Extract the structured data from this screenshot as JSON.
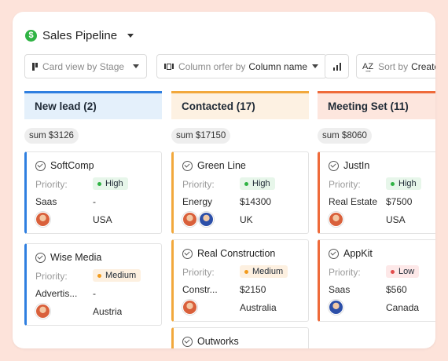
{
  "header": {
    "title": "Sales Pipeline",
    "icon": "dollar-icon"
  },
  "toolbar": {
    "view_label": "Card view by Stage",
    "column_order_prefix": "Column orfer by",
    "column_order_value": "Column name",
    "sort_prefix": "Sort by",
    "sort_value": "Create"
  },
  "colors": {
    "new_lead": "#2f7fe0",
    "contacted": "#f2a83c",
    "meeting": "#ef6a3a",
    "new_lead_bg": "#e4f0fb",
    "contacted_bg": "#fdf1e2",
    "meeting_bg": "#fde6de"
  },
  "columns": [
    {
      "title": "New lead (2)",
      "sum": "sum $3126",
      "cards": [
        {
          "name": "SoftComp",
          "priority_label": "Priority:",
          "priority": "High",
          "industry": "Saas",
          "amount": "-",
          "country": "USA"
        },
        {
          "name": "Wise Media",
          "priority_label": "Priority:",
          "priority": "Medium",
          "industry": "Advertis...",
          "amount": "-",
          "country": "Austria"
        }
      ]
    },
    {
      "title": "Contacted (17)",
      "sum": "sum $17150",
      "cards": [
        {
          "name": "Green Line",
          "priority_label": "Priority:",
          "priority": "High",
          "industry": "Energy",
          "amount": "$14300",
          "country": "UK"
        },
        {
          "name": "Real Construction",
          "priority_label": "Priority:",
          "priority": "Medium",
          "industry": "Constr...",
          "amount": "$2150",
          "country": "Australia"
        },
        {
          "name": "Outworks"
        }
      ]
    },
    {
      "title": "Meeting Set (11)",
      "sum": "sum $8060",
      "cards": [
        {
          "name": "JustIn",
          "priority_label": "Priority:",
          "priority": "High",
          "industry": "Real Estate",
          "amount": "$7500",
          "country": "USA"
        },
        {
          "name": "AppKit",
          "priority_label": "Priority:",
          "priority": "Low",
          "industry": "Saas",
          "amount": "$560",
          "country": "Canada"
        }
      ]
    }
  ]
}
